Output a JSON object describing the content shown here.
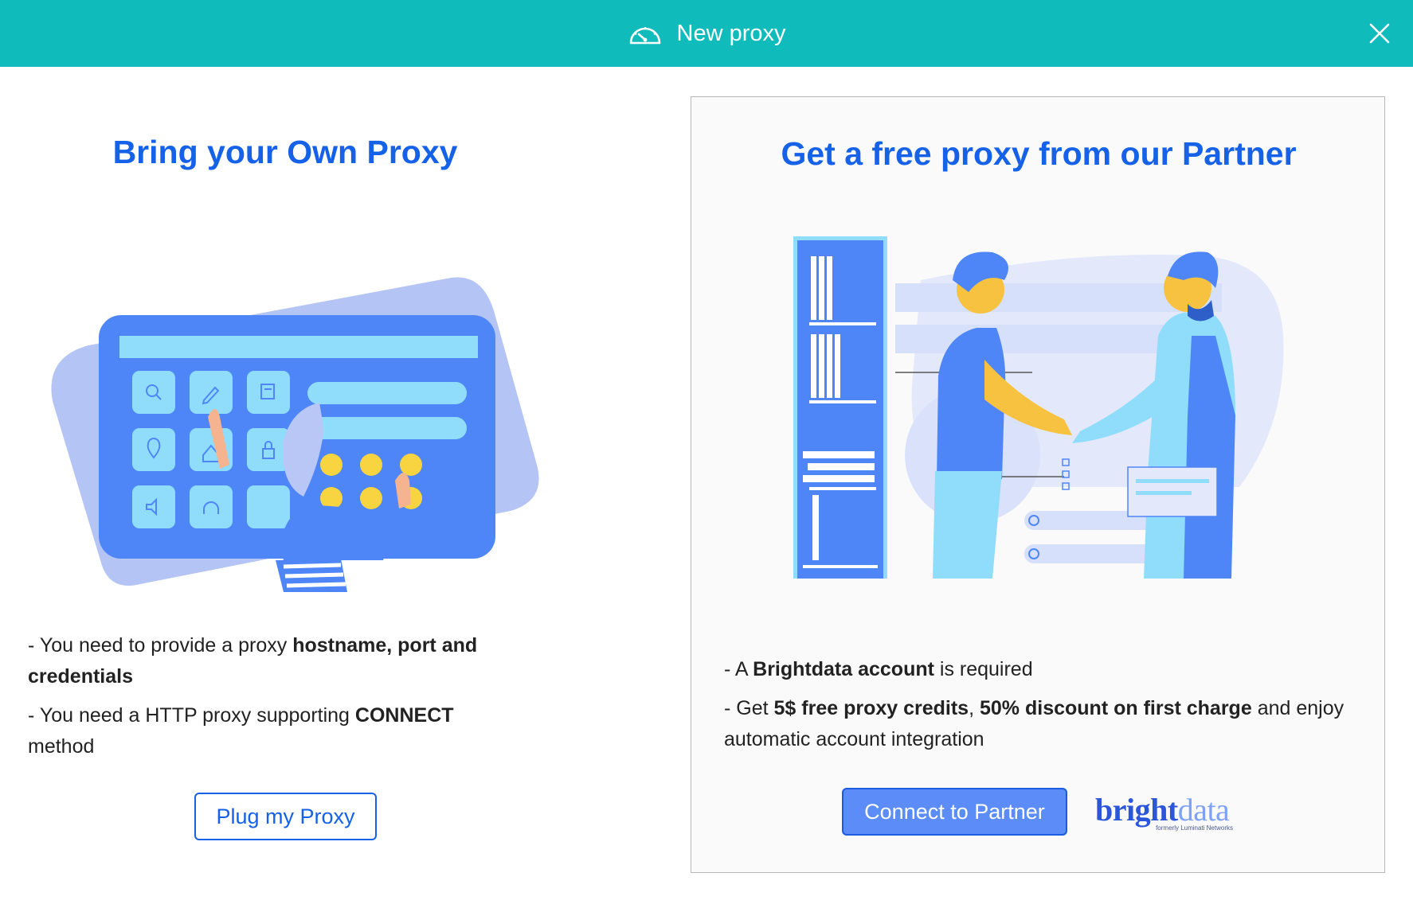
{
  "header": {
    "title": "New proxy",
    "icon": "speedometer-icon",
    "close_icon": "close-icon",
    "background": "#10BBBB"
  },
  "own_proxy": {
    "title": "Bring your Own Proxy",
    "bullet1": {
      "prefix": "- You need to provide a proxy ",
      "bold": "hostname, port and credentials"
    },
    "bullet2": {
      "prefix": "- You need a HTTP proxy supporting ",
      "bold": "CONNECT",
      "suffix": " method"
    },
    "button_label": "Plug my Proxy"
  },
  "partner": {
    "title": "Get a free proxy from our Partner",
    "bullet1": {
      "prefix": "- A ",
      "bold": "Brightdata account",
      "suffix": " is required"
    },
    "bullet2": {
      "prefix": "- Get ",
      "bold1": "5$ free proxy credits",
      "mid": ", ",
      "bold2": "50% discount on first charge",
      "suffix": " and enjoy automatic account integration"
    },
    "button_label": "Connect to Partner",
    "logo": {
      "word1": "bright",
      "word2": "data",
      "formerly": "formerly Luminati Networks"
    }
  },
  "colors": {
    "accent": "#1561E8",
    "header": "#10BBBB",
    "button_fill": "#5B8CF8"
  }
}
